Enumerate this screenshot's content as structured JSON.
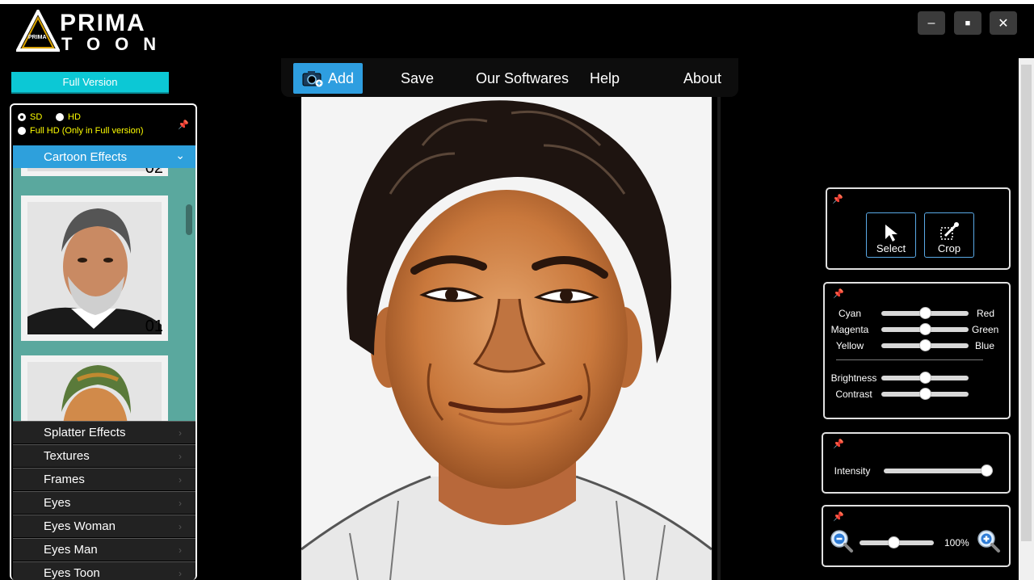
{
  "app": {
    "logo_prima": "PRIMA",
    "logo_toon": "TOON",
    "logo_small": "PRIMA"
  },
  "window": {
    "minimize": "–",
    "maximize": "■",
    "close": "✕"
  },
  "sidebar": {
    "full_version_label": "Full Version",
    "resolution": {
      "sd": "SD",
      "hd": "HD",
      "fullhd": "Full HD (Only in Full version)",
      "selected": "SD"
    },
    "active_category": "Cartoon Effects",
    "thumbnails": [
      {
        "num": "02"
      },
      {
        "num": "01"
      },
      {
        "num": ""
      }
    ],
    "categories": [
      "Splatter Effects",
      "Textures",
      "Frames",
      "Eyes",
      "Eyes Woman",
      "Eyes Man",
      "Eyes Toon"
    ]
  },
  "menu": {
    "add": "Add",
    "save": "Save",
    "our_softwares": "Our Softwares",
    "help": "Help",
    "about": "About"
  },
  "tools": {
    "select": "Select",
    "crop": "Crop"
  },
  "color_balance": {
    "cyan": "Cyan",
    "red": "Red",
    "cyan_red": 0.5,
    "magenta": "Magenta",
    "green": "Green",
    "magenta_green": 0.5,
    "yellow": "Yellow",
    "blue": "Blue",
    "yellow_blue": 0.5,
    "brightness": "Brightness",
    "brightness_value": 0.5,
    "contrast": "Contrast",
    "contrast_value": 0.5
  },
  "intensity": {
    "label": "Intensity",
    "value": 1.0
  },
  "zoom": {
    "value_label": "100%",
    "value": 0.45
  },
  "colors": {
    "accent_blue": "#2e9ee0",
    "full_version_cyan": "#0cc8d5",
    "thumb_bg": "#5aa89e",
    "radio_text": "#ffff00"
  }
}
